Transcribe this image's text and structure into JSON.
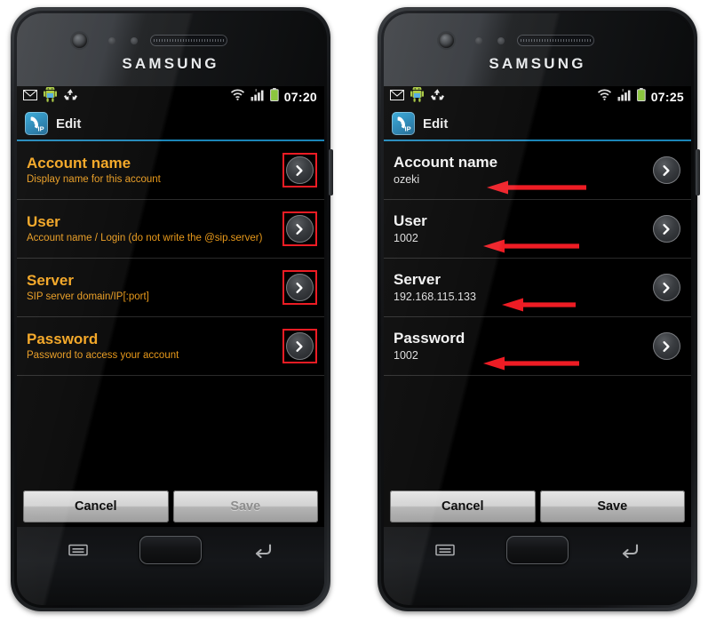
{
  "device": {
    "brand": "SAMSUNG",
    "hardware_keys": {
      "menu": "menu-key",
      "home": "home-key",
      "back": "back-key"
    }
  },
  "phones": [
    {
      "id": "left",
      "state": "empty",
      "statusbar": {
        "time": "07:20",
        "icons": [
          "mail-icon",
          "android-icon",
          "sync-icon",
          "wifi-icon",
          "signal-icon",
          "battery-icon"
        ]
      },
      "titlebar": {
        "icon": "ozeki-ip-phone-icon",
        "title": "Edit"
      },
      "rows": [
        {
          "title": "Account name",
          "sub": "Display name for this account",
          "highlight": true
        },
        {
          "title": "User",
          "sub": "Account name / Login (do not write the @sip.server)",
          "highlight": true
        },
        {
          "title": "Server",
          "sub": "SIP server domain/IP[:port]",
          "highlight": true
        },
        {
          "title": "Password",
          "sub": "Password to access your account",
          "highlight": true
        }
      ],
      "buttons": {
        "cancel": "Cancel",
        "save": "Save",
        "save_enabled": false
      }
    },
    {
      "id": "right",
      "state": "filled",
      "statusbar": {
        "time": "07:25",
        "icons": [
          "mail-icon",
          "android-icon",
          "sync-icon",
          "wifi-icon",
          "signal-icon",
          "battery-icon"
        ]
      },
      "titlebar": {
        "icon": "ozeki-ip-phone-icon",
        "title": "Edit"
      },
      "rows": [
        {
          "title": "Account name",
          "sub": "ozeki",
          "arrow": true
        },
        {
          "title": "User",
          "sub": "1002",
          "arrow": true
        },
        {
          "title": "Server",
          "sub": "192.168.115.133",
          "arrow": true
        },
        {
          "title": "Password",
          "sub": "1002",
          "arrow": true
        }
      ],
      "buttons": {
        "cancel": "Cancel",
        "save": "Save",
        "save_enabled": true
      }
    }
  ],
  "colors": {
    "prompt_orange": "#f3a31c",
    "value_white": "#f2f2f2",
    "annotation_red": "#ee1c24",
    "title_rule_blue": "#1b85b8",
    "battery_green": "#8cc63f"
  }
}
